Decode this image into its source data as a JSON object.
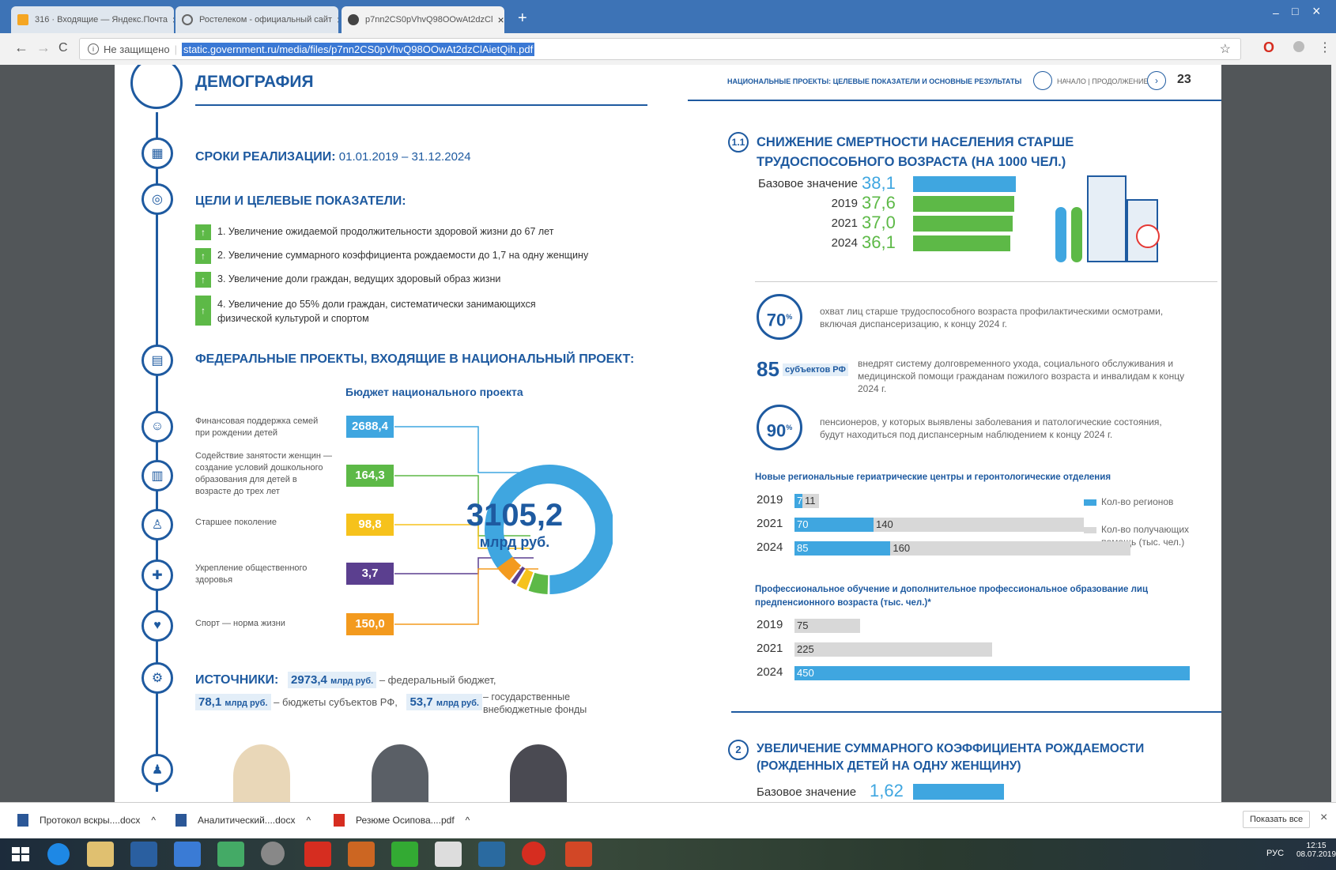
{
  "browser": {
    "tabs": [
      {
        "label": "316 · Входящие — Яндекс.Почта",
        "close": "×"
      },
      {
        "label": "Ростелеком - официальный сайт",
        "close": "×"
      },
      {
        "label": "p7nn2CS0pVhvQ98OOwAt2dzCl",
        "close": "×"
      }
    ],
    "new_tab": "+",
    "window_controls": {
      "minimize": "–",
      "maximize": "□",
      "close": "×"
    },
    "nav": {
      "back": "←",
      "forward": "→",
      "reload": "C"
    },
    "security_label": "Не защищено",
    "url": "static.government.ru/media/files/p7nn2CS0pVhvQ98OOwAt2dzClAietQih.pdf"
  },
  "left": {
    "title": "ДЕМОГРАФИЯ",
    "terms_label": "СРОКИ РЕАЛИЗАЦИИ:",
    "terms_value": "01.01.2019 – 31.12.2024",
    "goals_title": "ЦЕЛИ И ЦЕЛЕВЫЕ ПОКАЗАТЕЛИ:",
    "goals": [
      {
        "num": "1.",
        "text": "Увеличение ожидаемой продолжительности здоровой жизни до 67 лет"
      },
      {
        "num": "2.",
        "text": "Увеличение суммарного коэффициента рождаемости до 1,7 на одну женщину"
      },
      {
        "num": "3.",
        "text": "Увеличение доли граждан, ведущих здоровый образ жизни"
      },
      {
        "num": "4.",
        "text": "Увеличение до 55% доли граждан, систематически занимающихся физической культурой и спортом"
      }
    ],
    "fed_title": "ФЕДЕРАЛЬНЫЕ ПРОЕКТЫ, ВХОДЯЩИЕ В НАЦИОНАЛЬНЫЙ ПРОЕКТ:",
    "budget_title": "Бюджет национального проекта",
    "projects": [
      {
        "label": "Финансовая поддержка семей при рождении детей",
        "value": "2688,4",
        "color": "#3fa6e0"
      },
      {
        "label": "Содействие занятости женщин — создание условий дошкольного образования для детей в возрасте до трех лет",
        "value": "164,3",
        "color": "#5db947"
      },
      {
        "label": "Старшее поколение",
        "value": "98,8",
        "color": "#f6c21c"
      },
      {
        "label": "Укрепление общественного здоровья",
        "value": "3,7",
        "color": "#5b3f8f"
      },
      {
        "label": "Спорт — норма жизни",
        "value": "150,0",
        "color": "#f39a1e"
      }
    ],
    "donut_total": "3105,2",
    "donut_unit": "млрд руб.",
    "sources_label": "ИСТОЧНИКИ:",
    "sources": [
      {
        "value": "2973,4",
        "unit": "млрд руб.",
        "text": "– федеральный бюджет,"
      },
      {
        "value": "78,1",
        "unit": "млрд руб.",
        "text": "– бюджеты субъектов РФ,"
      },
      {
        "value": "53,7",
        "unit": "млрд руб.",
        "text": "– государственные внебюджетные фонды"
      }
    ]
  },
  "right": {
    "header_caption": "НАЦИОНАЛЬНЫЕ ПРОЕКТЫ: ЦЕЛЕВЫЕ ПОКАЗАТЕЛИ И ОСНОВНЫЕ РЕЗУЛЬТАТЫ",
    "nav_caption": "НАЧАЛО | ПРОДОЛЖЕНИЕ",
    "page_number": "23",
    "sec1_num": "1.1",
    "sec1_title": "СНИЖЕНИЕ СМЕРТНОСТИ НАСЕЛЕНИЯ СТАРШЕ ТРУДОСПОСОБНОГО ВОЗРАСТА (НА 1000 ЧЕЛ.)",
    "mortality": [
      {
        "label": "Базовое значение",
        "value": "38,1",
        "num": 38.1
      },
      {
        "label": "2019",
        "value": "37,6",
        "num": 37.6
      },
      {
        "label": "2021",
        "value": "37,0",
        "num": 37.0
      },
      {
        "label": "2024",
        "value": "36,1",
        "num": 36.1
      }
    ],
    "stats": [
      {
        "big": "70",
        "sup": "%",
        "text": "охват лиц старше трудоспособного возраста профилактическими осмотрами, включая диспансеризацию, к концу 2024 г."
      },
      {
        "big": "85",
        "sup": "субъектов РФ",
        "text": "внедрят систему долговременного ухода, социального обслуживания и медицинской помощи гражданам пожилого возраста и инвалидам к концу 2024 г."
      },
      {
        "big": "90",
        "sup": "%",
        "text": "пенсионеров, у которых выявлены заболевания и патологические состояния, будут находиться под диспансерным наблюдением к концу 2024 г."
      }
    ],
    "geriatric_title": "Новые региональные гериатрические центры и геронтологические отделения",
    "geriatric": [
      {
        "year": "2019",
        "regions": 7,
        "people": 11
      },
      {
        "year": "2021",
        "regions": 70,
        "people": 140
      },
      {
        "year": "2024",
        "regions": 85,
        "people": 160
      }
    ],
    "legend_regions": "Кол-во регионов",
    "legend_people": "Кол-во получающих помощь (тыс. чел.)",
    "edu_title": "Профессиональное обучение и дополнительное профессиональное образование лиц предпенсионного возраста (тыс. чел.)*",
    "edu": [
      {
        "year": "2019",
        "value": 75
      },
      {
        "year": "2021",
        "value": 225
      },
      {
        "year": "2024",
        "value": 450
      }
    ],
    "sec2_num": "2",
    "sec2_title": "УВЕЛИЧЕНИЕ СУММАРНОГО КОЭФФИЦИЕНТА РОЖДАЕМОСТИ (РОЖДЕННЫХ ДЕТЕЙ НА ОДНУ ЖЕНЩИНУ)",
    "sec2_base_label": "Базовое значение",
    "sec2_base_value": "1,62"
  },
  "downloads": [
    {
      "label": "Протокол вскры....docx",
      "arrow": "^"
    },
    {
      "label": "Аналитический....docx",
      "arrow": "^"
    },
    {
      "label": "Резюме Осипова....pdf",
      "arrow": "^"
    }
  ],
  "show_all": "Показать все",
  "taskbar": {
    "lang": "РУС",
    "time": "12:15",
    "date": "08.07.2019"
  }
}
